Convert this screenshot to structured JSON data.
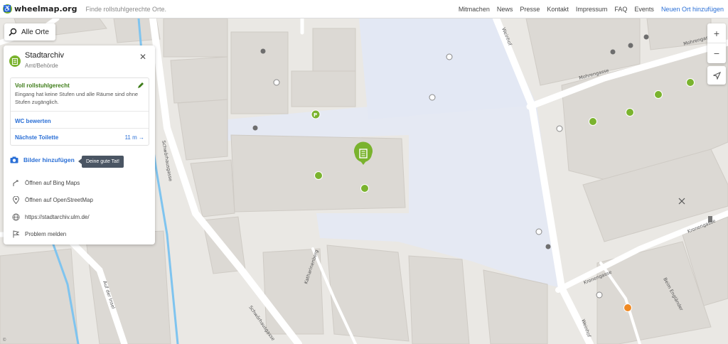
{
  "header": {
    "brand": "wheelmap.org",
    "tagline": "Finde rollstuhlgerechte Orte.",
    "nav": [
      {
        "label": "Mitmachen",
        "accent": false
      },
      {
        "label": "News",
        "accent": false
      },
      {
        "label": "Presse",
        "accent": false
      },
      {
        "label": "Kontakt",
        "accent": false
      },
      {
        "label": "Impressum",
        "accent": false
      },
      {
        "label": "FAQ",
        "accent": false
      },
      {
        "label": "Events",
        "accent": false
      },
      {
        "label": "Neuen Ort hinzufügen",
        "accent": true
      }
    ]
  },
  "search": {
    "label": "Alle Orte",
    "icon": "search-icon"
  },
  "place": {
    "name": "Stadtarchiv",
    "category": "Amt/Behörde",
    "icon": "building-icon",
    "accessibility": {
      "title": "Voll rollstuhlgerecht",
      "description": "Eingang hat keine Stufen und alle Räume sind ohne Stufen zugänglich."
    },
    "wc_link": "WC bewerten",
    "toilet_link": "Nächste Toilette",
    "toilet_distance": "11 m →",
    "add_photos": "Bilder hinzufügen",
    "tooltip": "Deine gute Tat!",
    "links": [
      {
        "label": "Öffnen auf Bing Maps",
        "icon": "route-icon"
      },
      {
        "label": "Öffnen auf OpenStreetMap",
        "icon": "map-pin-icon"
      },
      {
        "label": "https://stadtarchiv.ulm.de/",
        "icon": "globe-icon"
      },
      {
        "label": "Problem melden",
        "icon": "flag-icon"
      }
    ]
  },
  "map": {
    "streets": [
      "Weinhof",
      "Mohrengasse",
      "Mohrengasse",
      "Kronengasse",
      "Kronengasse",
      "Schwörhausgasse",
      "Schwörhausgasse",
      "Katharinenberg",
      "Beim Engländer",
      "Auf der Insel",
      "Weinhof"
    ],
    "attribution": "©",
    "colors": {
      "accessible": "#7ab32e",
      "limited": "#f08a24",
      "background": "#eae8e4",
      "plaza": "#e5e9f3",
      "water": "#7fc4ef"
    }
  },
  "controls": {
    "zoom_in": "+",
    "zoom_out": "−"
  }
}
